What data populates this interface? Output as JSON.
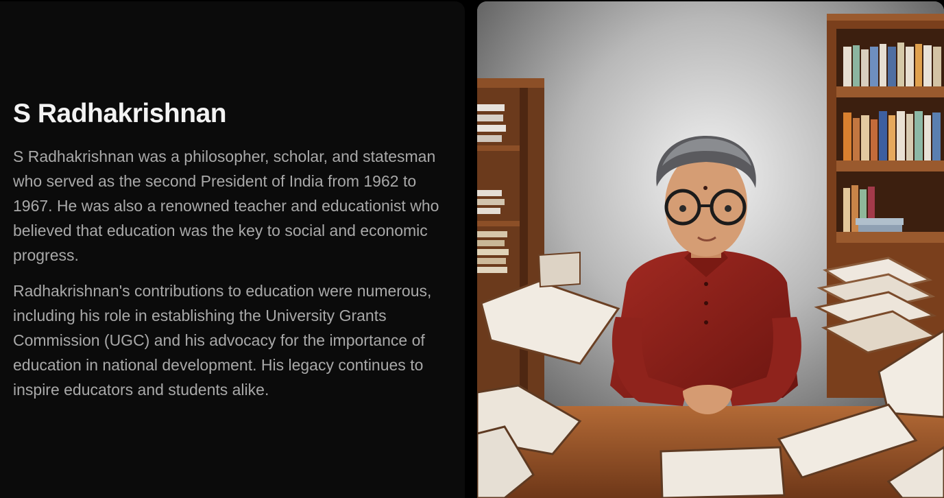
{
  "card": {
    "title": "S Radhakrishnan",
    "paragraphs": [
      "S Radhakrishnan was a philosopher, scholar, and statesman who served as the second President of India from 1962 to 1967. He was also a renowned teacher and educationist who believed that education was the key to social and economic progress.",
      "Radhakrishnan's contributions to education were numerous, including his role in establishing the University Grants Commission (UGC) and his advocacy for the importance of education in national development. His legacy continues to inspire educators and students alike."
    ]
  },
  "colors": {
    "panel_bg": "#0b0b0b",
    "title": "#f3f3f3",
    "body": "#a9a9a9"
  }
}
